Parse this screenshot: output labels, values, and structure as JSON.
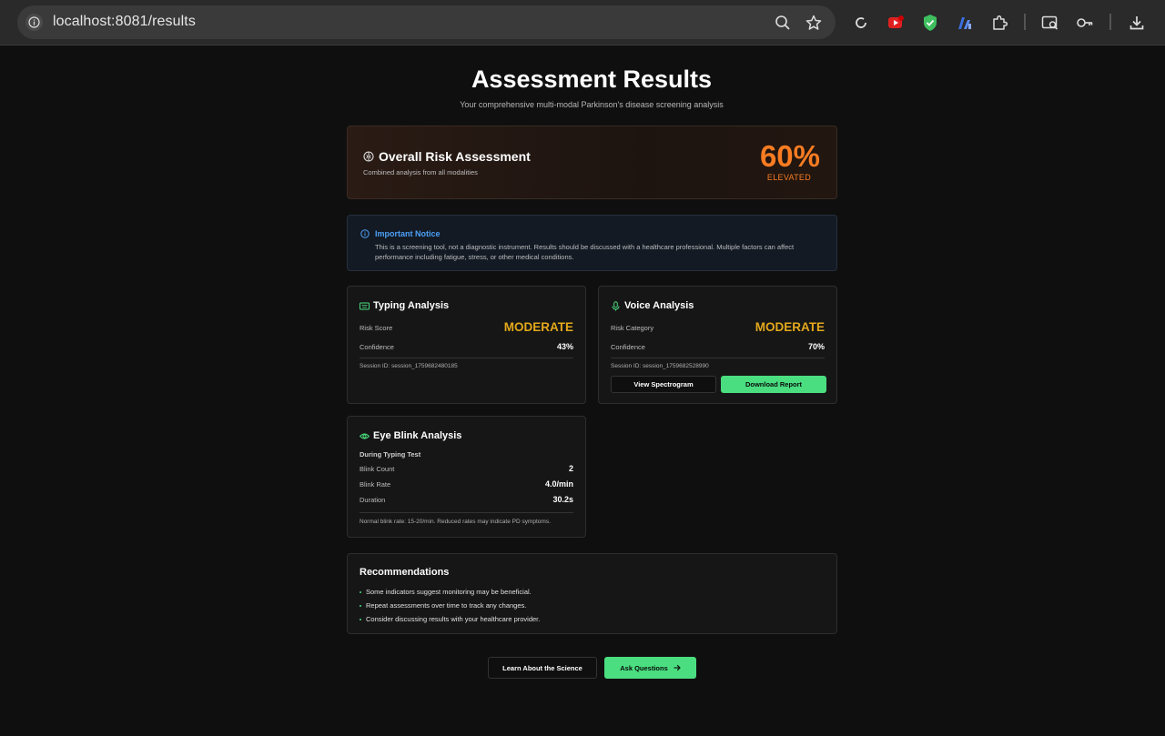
{
  "browser": {
    "url": "localhost:8081/results",
    "icons": [
      "info-icon",
      "zoom-icon",
      "bookmark-star-icon",
      "sync-icon",
      "youtube-extension-icon",
      "shield-extension-icon",
      "chart-extension-icon",
      "puzzle-extensions-icon",
      "search-tab-icon",
      "password-key-icon",
      "download-icon"
    ]
  },
  "page": {
    "title": "Assessment Results",
    "subtitle": "Your comprehensive multi-modal Parkinson's disease screening analysis"
  },
  "overall": {
    "title": "Overall Risk Assessment",
    "subtitle": "Combined analysis from all modalities",
    "percent": "60%",
    "level": "ELEVATED",
    "accent": "#f97c22"
  },
  "notice": {
    "title": "Important Notice",
    "body": "This is a screening tool, not a diagnostic instrument. Results should be discussed with a healthcare professional. Multiple factors can affect performance including fatigue, stress, or other medical conditions."
  },
  "typing": {
    "title": "Typing Analysis",
    "risk_label": "Risk Score",
    "risk_value": "MODERATE",
    "confidence_label": "Confidence",
    "confidence_value": "43%",
    "session": "Session ID: session_1759682480185"
  },
  "voice": {
    "title": "Voice Analysis",
    "risk_label": "Risk Category",
    "risk_value": "MODERATE",
    "confidence_label": "Confidence",
    "confidence_value": "70%",
    "session": "Session ID: session_1759682528990",
    "spectrogram_button": "View Spectrogram",
    "download_button": "Download Report"
  },
  "blink": {
    "title": "Eye Blink Analysis",
    "context": "During Typing Test",
    "count_label": "Blink Count",
    "count_value": "2",
    "rate_label": "Blink Rate",
    "rate_value": "4.0/min",
    "duration_label": "Duration",
    "duration_value": "30.2s",
    "note": "Normal blink rate: 15-20/min. Reduced rates may indicate PD symptoms."
  },
  "recommendations": {
    "title": "Recommendations",
    "items": [
      "Some indicators suggest monitoring may be beneficial.",
      "Repeat assessments over time to track any changes.",
      "Consider discussing results with your healthcare provider."
    ]
  },
  "footer": {
    "science_button": "Learn About the Science",
    "questions_button": "Ask Questions"
  },
  "colors": {
    "moderate": "#e3a81b",
    "green": "#4ade80",
    "notice_blue": "#4ea0f5"
  }
}
